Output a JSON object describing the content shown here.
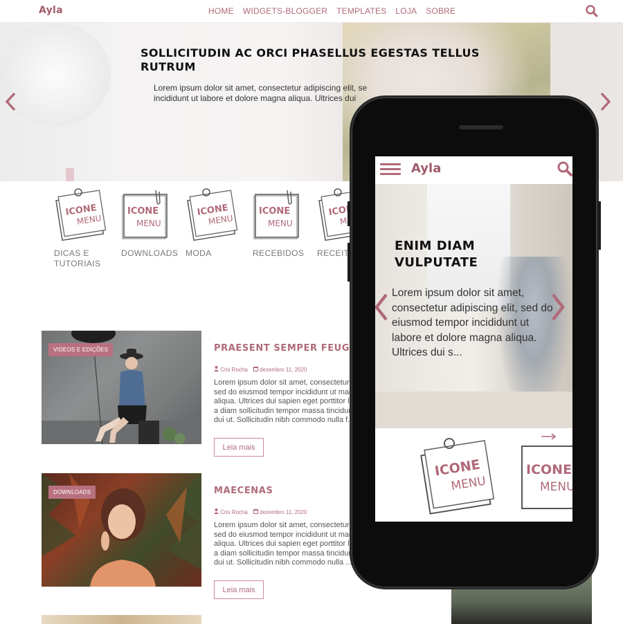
{
  "site": {
    "logo": "Ayla"
  },
  "nav": {
    "items": [
      "HOME",
      "WIDGETS-BLOGGER",
      "TEMPLATES",
      "LOJA",
      "SOBRE"
    ]
  },
  "hero": {
    "title": "SOLLICITUDIN AC ORCI PHASELLUS EGESTAS TELLUS RUTRUM",
    "text": "Lorem ipsum dolor sit amet, consectetur adipiscing elit, se incididunt ut labore et dolore magna aliqua. Ultrices dui"
  },
  "categories": [
    {
      "label": "DICAS E TUTORIAIS"
    },
    {
      "label": "DOWNLOADS"
    },
    {
      "label": "MODA"
    },
    {
      "label": "RECEBIDOS"
    },
    {
      "label": "RECEIT"
    }
  ],
  "icon_art": {
    "line1": "ICONE",
    "line2": "MENU"
  },
  "posts": [
    {
      "tag": "VIDEOS E EDIÇÕES",
      "title": "PRAESENT SEMPER FEUGIAT",
      "author": "Cris Rocha",
      "date": "dezembro 11, 2020",
      "excerpt": "Lorem ipsum dolor sit amet, consectetur sed do eiusmod tempor incididunt ut magna aliqua. Ultrices dui sapien eget porttitor leo a diam sollicitudin tempor massa tincidunt dui ut. Sollicitudin nibh commodo nulla f...",
      "button": "Leia mais"
    },
    {
      "tag": "DOWNLOADS",
      "title": "MAECENAS",
      "author": "Cris Rocha",
      "date": "dezembro 11, 2020",
      "excerpt": "Lorem ipsum dolor sit amet, consectetur sed do eiusmod tempor incididunt ut magna aliqua. Ultrices dui sapien eget porttitor leo a diam sollicitudin tempor massa tincidunt dui ut. Sollicitudin nibh commodo nulla ...",
      "button": "Leia mais"
    }
  ],
  "mobile": {
    "logo": "Ayla",
    "slide_title": "ENIM DIAM VULPUTATE",
    "slide_text": "Lorem ipsum dolor sit amet, consectetur adipiscing elit, sed do eiusmod tempor incididunt ut labore et dolore magna aliqua. Ultrices dui s..."
  },
  "colors": {
    "accent": "#b06a79",
    "logo": "#a05b6a",
    "tag_bg": "#b9717f"
  },
  "icons": [
    "search-icon",
    "chevron-left-icon",
    "chevron-right-icon",
    "hamburger-icon",
    "user-icon",
    "calendar-icon",
    "arrow-right-icon"
  ]
}
